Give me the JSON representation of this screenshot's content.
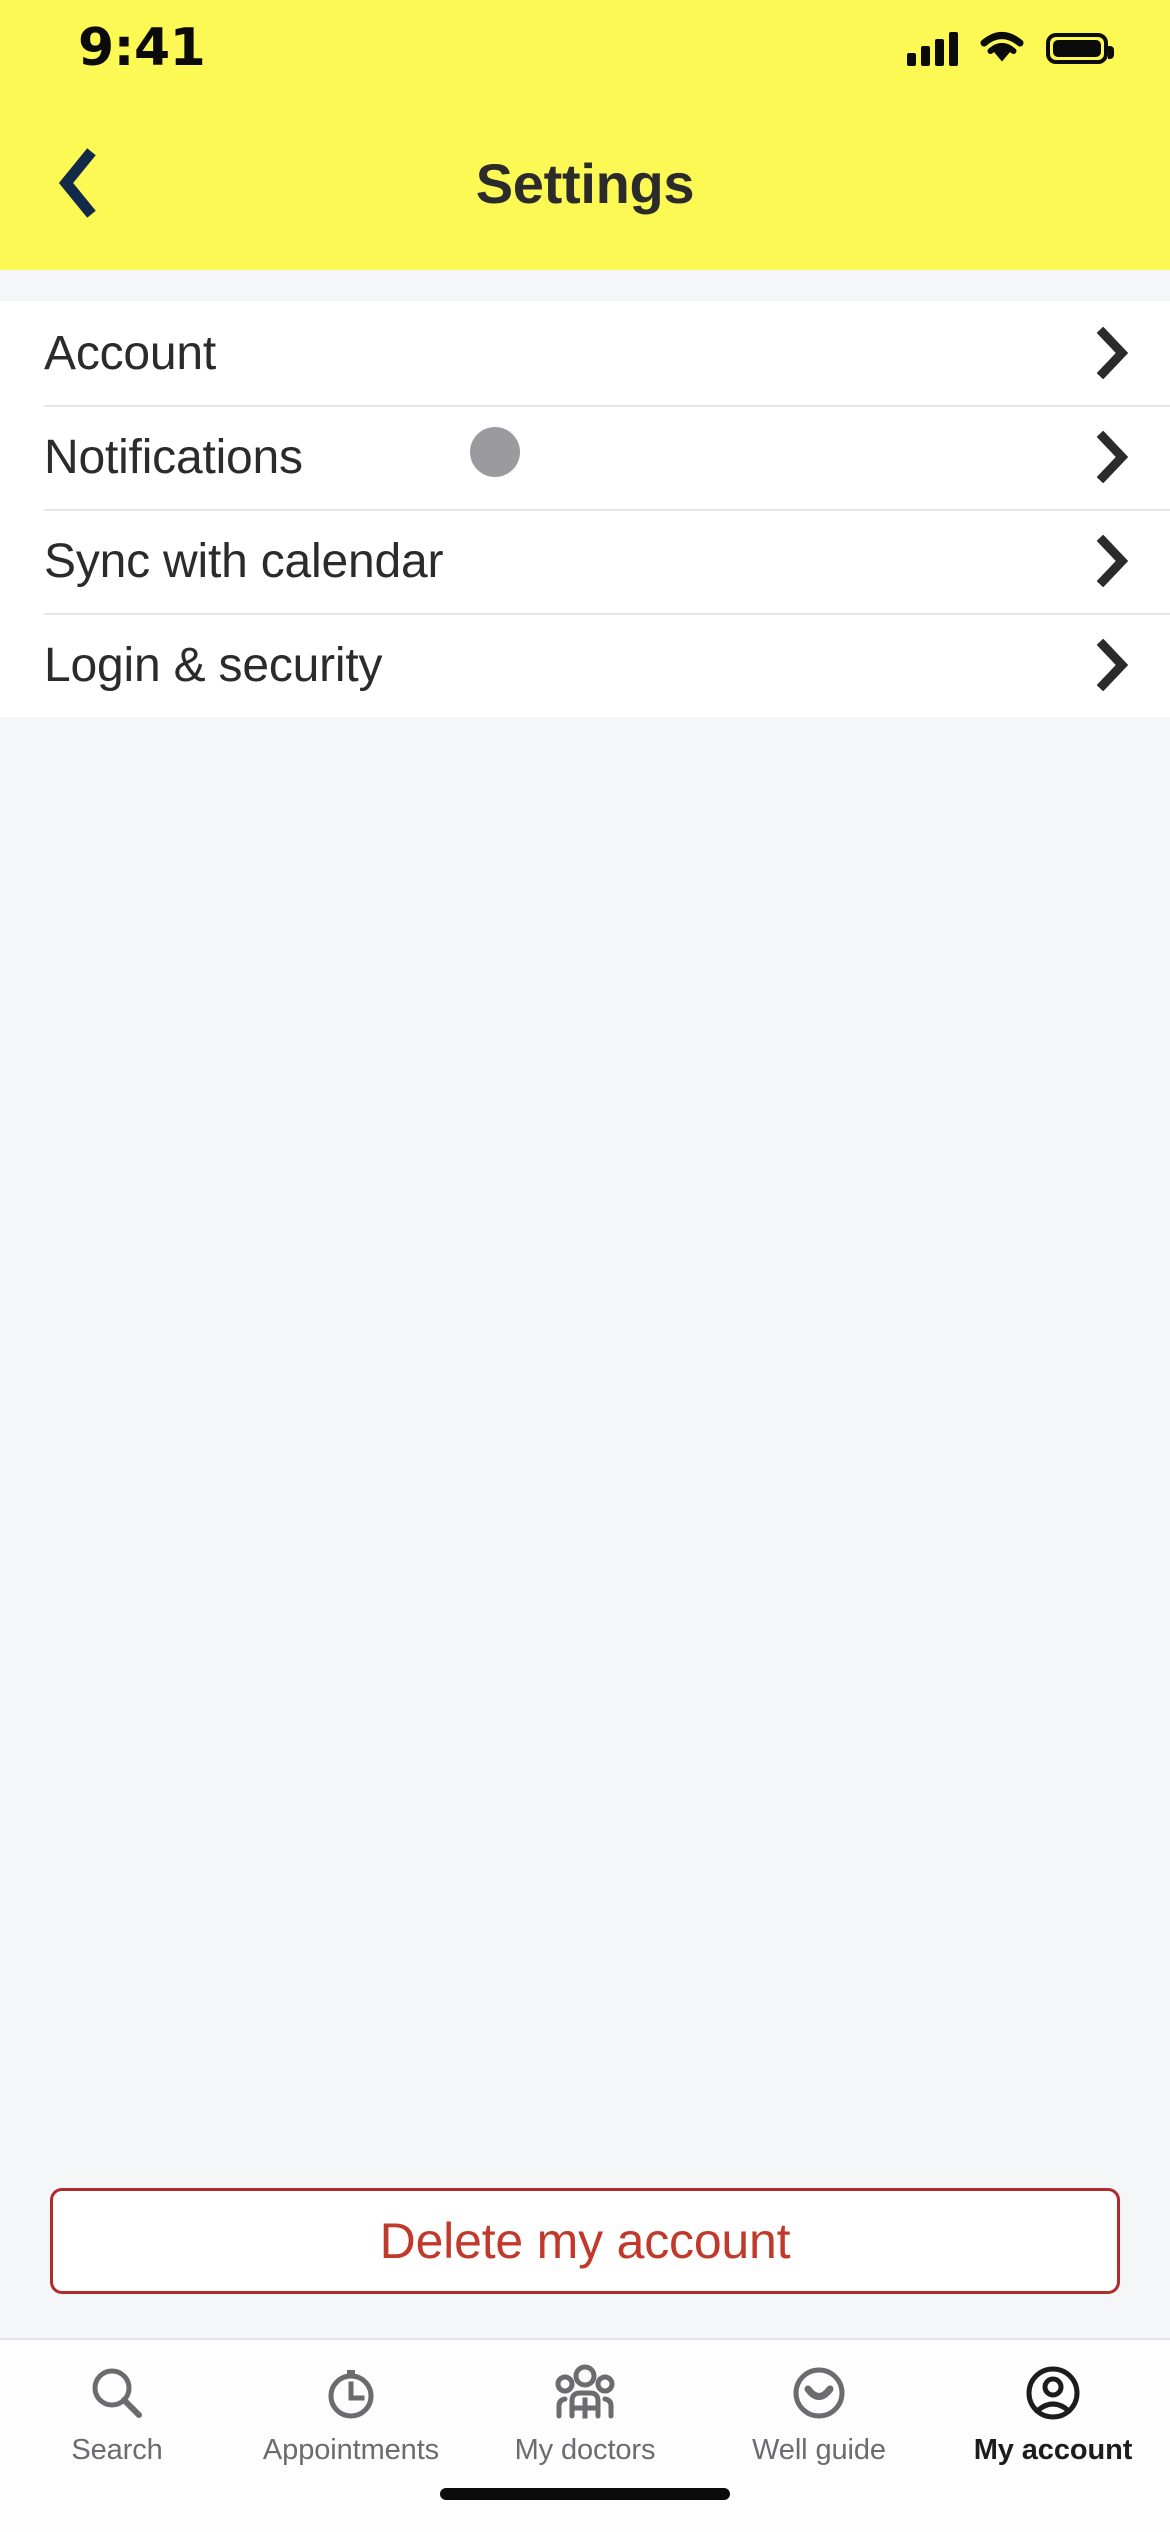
{
  "status_bar": {
    "time": "9:41",
    "signal_icon": "cellular-signal-icon",
    "wifi_icon": "wifi-icon",
    "battery_icon": "battery-full-icon"
  },
  "header": {
    "title": "Settings",
    "back_icon": "chevron-left-icon",
    "background_color": "#FCF954",
    "title_color": "#2B2B2B",
    "back_icon_color": "#12294A"
  },
  "settings_list": {
    "rows": [
      {
        "label": "Account",
        "has_badge": false,
        "chevron_icon": "chevron-right-icon"
      },
      {
        "label": "Notifications",
        "has_badge": true,
        "badge_color": "#9B9B9F",
        "chevron_icon": "chevron-right-icon"
      },
      {
        "label": "Sync with calendar",
        "has_badge": false,
        "chevron_icon": "chevron-right-icon"
      },
      {
        "label": "Login & security",
        "has_badge": false,
        "chevron_icon": "chevron-right-icon"
      }
    ]
  },
  "delete_account": {
    "label": "Delete my account",
    "text_color": "#C0392B",
    "border_color": "#B02B2B"
  },
  "tab_bar": {
    "active_index": 4,
    "inactive_color": "#6B6B70",
    "active_color": "#1C1C1E",
    "tabs": [
      {
        "label": "Search",
        "icon": "search-icon"
      },
      {
        "label": "Appointments",
        "icon": "clock-icon"
      },
      {
        "label": "My doctors",
        "icon": "doctors-group-icon"
      },
      {
        "label": "Well guide",
        "icon": "smiley-face-icon"
      },
      {
        "label": "My account",
        "icon": "user-circle-icon"
      }
    ]
  }
}
